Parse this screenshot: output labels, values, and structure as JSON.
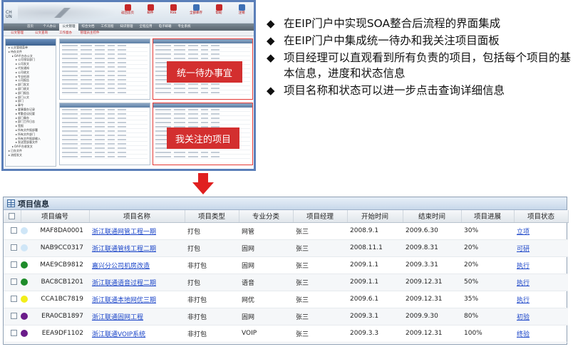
{
  "portal": {
    "logo_text": "CH\nUN",
    "top_icons": [
      {
        "label": "返回首页",
        "color": "#c62828"
      },
      {
        "label": "邮件",
        "color": "#c62828"
      },
      {
        "label": "RSS",
        "color": "#c62828"
      },
      {
        "label": "全部库存",
        "color": "#3d6fb4"
      },
      {
        "label": "帮助",
        "color": "#c62828"
      },
      {
        "label": "注销",
        "color": "#3d6fb4"
      }
    ],
    "nav_main": [
      "首页",
      "个人办公",
      "公文管理",
      "综合文档",
      "工作流程",
      "知识管理",
      "全程应用",
      "电子邮箱",
      "专业系统"
    ],
    "nav_main_active": 2,
    "nav_sub": [
      "公文管理",
      "公文查询",
      "工作督办",
      "管理员主控件"
    ],
    "tree_items": [
      {
        "label": "公文管理菜单",
        "level": 1
      },
      {
        "label": "待办文件",
        "level": 1
      },
      {
        "label": "OA平台办公文",
        "level": 2
      },
      {
        "label": "公司领导部门",
        "level": 3
      },
      {
        "label": "公司发文",
        "level": 3
      },
      {
        "label": "代发通知",
        "level": 3
      },
      {
        "label": "公司收文",
        "level": 3
      },
      {
        "label": "专业检测",
        "level": 3
      },
      {
        "label": "公司报告",
        "level": 3
      },
      {
        "label": "部门发文",
        "level": 3
      },
      {
        "label": "部门收文",
        "level": 3
      },
      {
        "label": "部门报告",
        "level": 3
      },
      {
        "label": "部门公文",
        "level": 3
      },
      {
        "label": "部门",
        "level": 3
      },
      {
        "label": "章令",
        "level": 3
      },
      {
        "label": "要事督办记录",
        "level": 3
      },
      {
        "label": "考勤会议纪要",
        "level": 3
      },
      {
        "label": "部门督办",
        "level": 3
      },
      {
        "label": "部门工作日志",
        "level": 3
      },
      {
        "label": "签报",
        "level": 3
      },
      {
        "label": "所有文件报部署",
        "level": 3
      },
      {
        "label": "所有文件部门",
        "level": 3
      },
      {
        "label": "所有文件报部输入",
        "level": 3
      },
      {
        "label": "发送受部督文件",
        "level": 3
      },
      {
        "label": "OA平台收发文",
        "level": 2
      },
      {
        "label": "已办文件",
        "level": 1
      },
      {
        "label": "流程发文",
        "level": 1
      }
    ],
    "labels": {
      "todo": "统一待办事宜",
      "focus": "我关注的项目"
    }
  },
  "bullets": [
    "在EIP门户中实现SOA整合后流程的界面集成",
    "在EIP门户中集成统一待办和我关注项目面板",
    "项目经理可以直观看到所有负责的项目，包括每个项目的基本信息，进度和状态信息",
    "项目名称和状态可以进一步点击查询详细信息"
  ],
  "project_panel": {
    "title": "项目信息",
    "columns": [
      "",
      "项目编号",
      "项目名称",
      "项目类型",
      "专业分类",
      "项目经理",
      "开始时间",
      "结束时间",
      "项目进展",
      "项目状态"
    ],
    "rows": [
      {
        "status_color": "#cfe6f7",
        "code": "MAF8DA0001",
        "name": "浙江联通网管工程一期",
        "type": "打包",
        "category": "网管",
        "manager": "张三",
        "start": "2008.9.1",
        "end": "2009.6.30",
        "progress": "30%",
        "status": "立项"
      },
      {
        "status_color": "#cfe6f7",
        "code": "NAB9CC0317",
        "name": "浙江联通管线工程二期",
        "type": "打包",
        "category": "固网",
        "manager": "张三",
        "start": "2008.11.1",
        "end": "2009.8.31",
        "progress": "20%",
        "status": "可研"
      },
      {
        "status_color": "#1e8c2a",
        "code": "MAE9CB9812",
        "name": "嘉兴分公司机房改造",
        "type": "非打包",
        "category": "固网",
        "manager": "张三",
        "start": "2009.1.1",
        "end": "2009.3.31",
        "progress": "20%",
        "status": "执行"
      },
      {
        "status_color": "#1e8c2a",
        "code": "BAC8CB1201",
        "name": "浙江联通语音过程二期",
        "type": "打包",
        "category": "语音",
        "manager": "张三",
        "start": "2009.1.1",
        "end": "2009.12.31",
        "progress": "50%",
        "status": "执行"
      },
      {
        "status_color": "#f2ee1a",
        "code": "CCA1BC7819",
        "name": "浙江联通本地网优三期",
        "type": "非打包",
        "category": "网优",
        "manager": "张三",
        "start": "2009.6.1",
        "end": "2009.12.31",
        "progress": "35%",
        "status": "执行"
      },
      {
        "status_color": "#6a1b8a",
        "code": "ERA0CB1897",
        "name": "浙江联通固网工程",
        "type": "非打包",
        "category": "固网",
        "manager": "张三",
        "start": "2009.3.1",
        "end": "2009.9.30",
        "progress": "80%",
        "status": "初验"
      },
      {
        "status_color": "#6a1b8a",
        "code": "EEA9DF1102",
        "name": "浙江联通VOIP系统",
        "type": "非打包",
        "category": "VOIP",
        "manager": "张三",
        "start": "2009.3.3",
        "end": "2009.12.31",
        "progress": "100%",
        "status": "终验"
      }
    ]
  },
  "colors": {
    "accent_red": "#d32f2f",
    "frame_blue": "#5b7fb9",
    "link_blue": "#1a44c8"
  }
}
